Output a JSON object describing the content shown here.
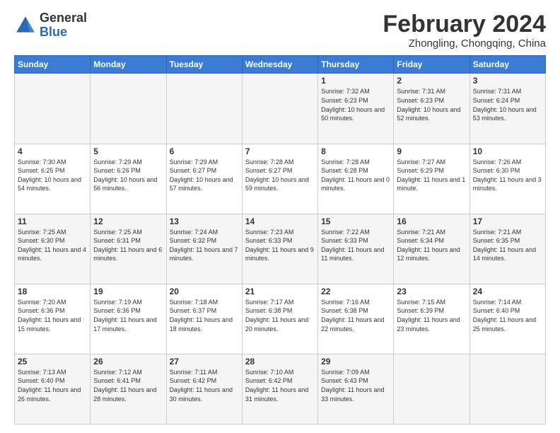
{
  "header": {
    "logo_general": "General",
    "logo_blue": "Blue",
    "month_year": "February 2024",
    "location": "Zhongling, Chongqing, China"
  },
  "days_of_week": [
    "Sunday",
    "Monday",
    "Tuesday",
    "Wednesday",
    "Thursday",
    "Friday",
    "Saturday"
  ],
  "weeks": [
    [
      {
        "day": "",
        "info": ""
      },
      {
        "day": "",
        "info": ""
      },
      {
        "day": "",
        "info": ""
      },
      {
        "day": "",
        "info": ""
      },
      {
        "day": "1",
        "info": "Sunrise: 7:32 AM\nSunset: 6:23 PM\nDaylight: 10 hours and 50 minutes."
      },
      {
        "day": "2",
        "info": "Sunrise: 7:31 AM\nSunset: 6:23 PM\nDaylight: 10 hours and 52 minutes."
      },
      {
        "day": "3",
        "info": "Sunrise: 7:31 AM\nSunset: 6:24 PM\nDaylight: 10 hours and 53 minutes."
      }
    ],
    [
      {
        "day": "4",
        "info": "Sunrise: 7:30 AM\nSunset: 6:25 PM\nDaylight: 10 hours and 54 minutes."
      },
      {
        "day": "5",
        "info": "Sunrise: 7:29 AM\nSunset: 6:26 PM\nDaylight: 10 hours and 56 minutes."
      },
      {
        "day": "6",
        "info": "Sunrise: 7:29 AM\nSunset: 6:27 PM\nDaylight: 10 hours and 57 minutes."
      },
      {
        "day": "7",
        "info": "Sunrise: 7:28 AM\nSunset: 6:27 PM\nDaylight: 10 hours and 59 minutes."
      },
      {
        "day": "8",
        "info": "Sunrise: 7:28 AM\nSunset: 6:28 PM\nDaylight: 11 hours and 0 minutes."
      },
      {
        "day": "9",
        "info": "Sunrise: 7:27 AM\nSunset: 6:29 PM\nDaylight: 11 hours and 1 minute."
      },
      {
        "day": "10",
        "info": "Sunrise: 7:26 AM\nSunset: 6:30 PM\nDaylight: 11 hours and 3 minutes."
      }
    ],
    [
      {
        "day": "11",
        "info": "Sunrise: 7:25 AM\nSunset: 6:30 PM\nDaylight: 11 hours and 4 minutes."
      },
      {
        "day": "12",
        "info": "Sunrise: 7:25 AM\nSunset: 6:31 PM\nDaylight: 11 hours and 6 minutes."
      },
      {
        "day": "13",
        "info": "Sunrise: 7:24 AM\nSunset: 6:32 PM\nDaylight: 11 hours and 7 minutes."
      },
      {
        "day": "14",
        "info": "Sunrise: 7:23 AM\nSunset: 6:33 PM\nDaylight: 11 hours and 9 minutes."
      },
      {
        "day": "15",
        "info": "Sunrise: 7:22 AM\nSunset: 6:33 PM\nDaylight: 11 hours and 11 minutes."
      },
      {
        "day": "16",
        "info": "Sunrise: 7:21 AM\nSunset: 6:34 PM\nDaylight: 11 hours and 12 minutes."
      },
      {
        "day": "17",
        "info": "Sunrise: 7:21 AM\nSunset: 6:35 PM\nDaylight: 11 hours and 14 minutes."
      }
    ],
    [
      {
        "day": "18",
        "info": "Sunrise: 7:20 AM\nSunset: 6:36 PM\nDaylight: 11 hours and 15 minutes."
      },
      {
        "day": "19",
        "info": "Sunrise: 7:19 AM\nSunset: 6:36 PM\nDaylight: 11 hours and 17 minutes."
      },
      {
        "day": "20",
        "info": "Sunrise: 7:18 AM\nSunset: 6:37 PM\nDaylight: 11 hours and 18 minutes."
      },
      {
        "day": "21",
        "info": "Sunrise: 7:17 AM\nSunset: 6:38 PM\nDaylight: 11 hours and 20 minutes."
      },
      {
        "day": "22",
        "info": "Sunrise: 7:16 AM\nSunset: 6:38 PM\nDaylight: 11 hours and 22 minutes."
      },
      {
        "day": "23",
        "info": "Sunrise: 7:15 AM\nSunset: 6:39 PM\nDaylight: 11 hours and 23 minutes."
      },
      {
        "day": "24",
        "info": "Sunrise: 7:14 AM\nSunset: 6:40 PM\nDaylight: 11 hours and 25 minutes."
      }
    ],
    [
      {
        "day": "25",
        "info": "Sunrise: 7:13 AM\nSunset: 6:40 PM\nDaylight: 11 hours and 26 minutes."
      },
      {
        "day": "26",
        "info": "Sunrise: 7:12 AM\nSunset: 6:41 PM\nDaylight: 11 hours and 28 minutes."
      },
      {
        "day": "27",
        "info": "Sunrise: 7:11 AM\nSunset: 6:42 PM\nDaylight: 11 hours and 30 minutes."
      },
      {
        "day": "28",
        "info": "Sunrise: 7:10 AM\nSunset: 6:42 PM\nDaylight: 11 hours and 31 minutes."
      },
      {
        "day": "29",
        "info": "Sunrise: 7:09 AM\nSunset: 6:43 PM\nDaylight: 11 hours and 33 minutes."
      },
      {
        "day": "",
        "info": ""
      },
      {
        "day": "",
        "info": ""
      }
    ]
  ]
}
